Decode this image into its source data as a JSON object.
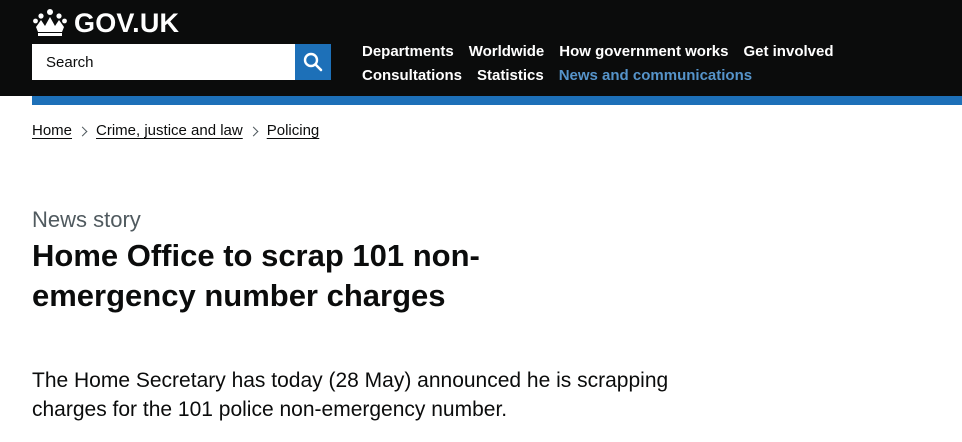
{
  "header": {
    "logo_text": "GOV.UK",
    "search": {
      "placeholder": "Search"
    },
    "nav": [
      {
        "label": "Departments",
        "active": false
      },
      {
        "label": "Worldwide",
        "active": false
      },
      {
        "label": "How government works",
        "active": false
      },
      {
        "label": "Get involved",
        "active": false
      },
      {
        "label": "Consultations",
        "active": false
      },
      {
        "label": "Statistics",
        "active": false
      },
      {
        "label": "News and communications",
        "active": true
      }
    ]
  },
  "breadcrumb": [
    {
      "label": "Home"
    },
    {
      "label": "Crime, justice and law"
    },
    {
      "label": "Policing"
    }
  ],
  "article": {
    "caption": "News story",
    "title": "Home Office to scrap 101 non-emergency number charges",
    "lead": "The Home Secretary has today (28 May) announced he is scrapping charges for the 101 police non-emergency number."
  },
  "colors": {
    "header_bg": "#0b0c0c",
    "brand_blue": "#1d70b8",
    "active_link": "#5694ca",
    "secondary_text": "#505a5f"
  }
}
